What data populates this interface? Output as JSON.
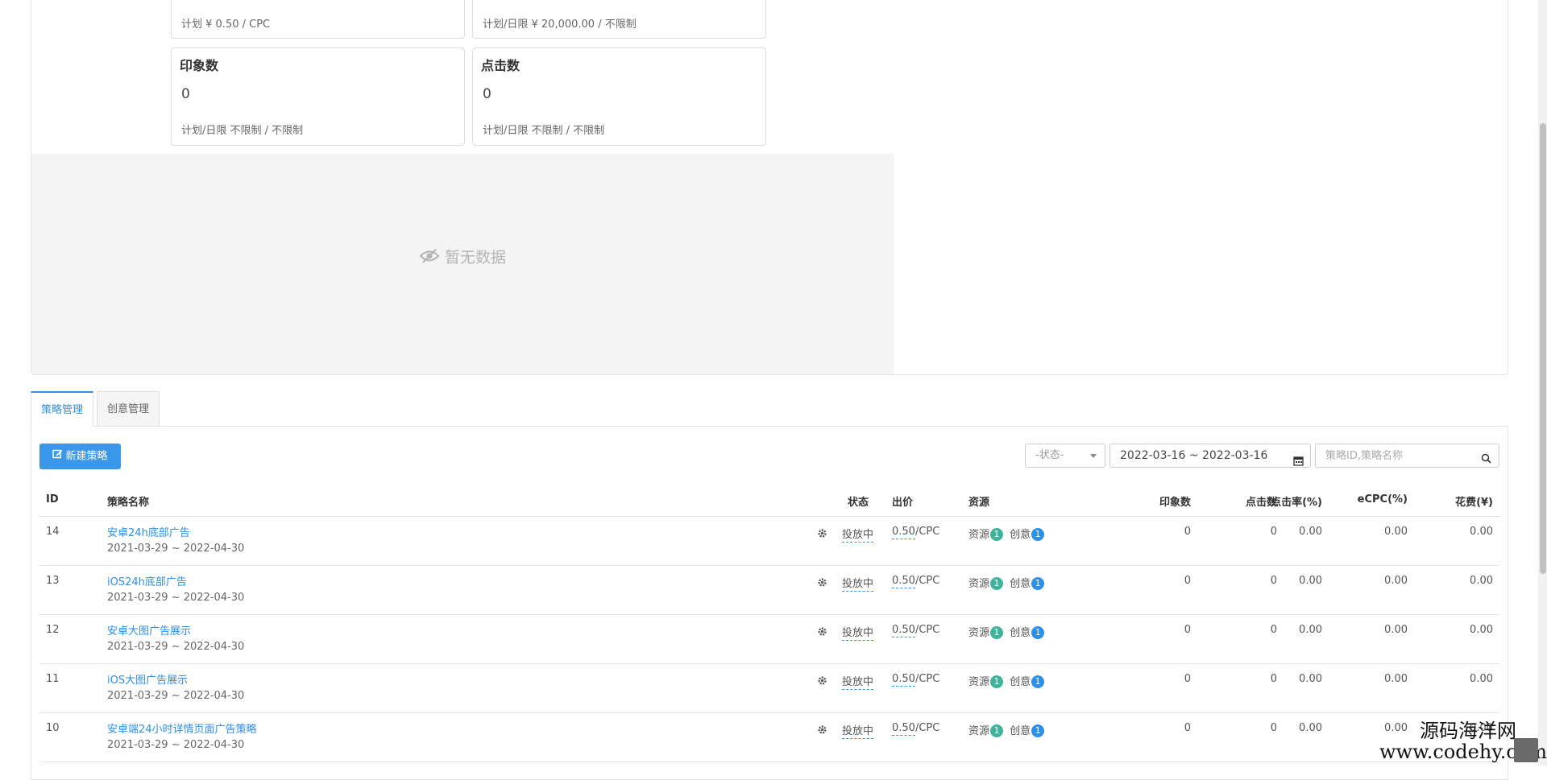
{
  "cards": {
    "top_left": {
      "note": "计划 ¥ 0.50 / CPC"
    },
    "top_right": {
      "note": "计划/日限 ¥ 20,000.00 / 不限制"
    },
    "impressions": {
      "title": "印象数",
      "value": "0",
      "note": "计划/日限 不限制 / 不限制"
    },
    "clicks": {
      "title": "点击数",
      "value": "0",
      "note": "计划/日限 不限制 / 不限制"
    }
  },
  "empty_state": {
    "text": "暂无数据",
    "icon": "eye-slash-icon"
  },
  "tabs": [
    {
      "label": "策略管理",
      "active": true
    },
    {
      "label": "创意管理",
      "active": false
    }
  ],
  "toolbar": {
    "new_button": "新建策略",
    "status_select": "-状态-",
    "date_range": "2022-03-16 ~ 2022-03-16",
    "search_placeholder": "策略ID,策略名称"
  },
  "table": {
    "headers": {
      "id": "ID",
      "name": "策略名称",
      "status": "状态",
      "bid": "出价",
      "resource": "资源",
      "impressions": "印象数",
      "clicks": "点击数",
      "ctr": "点击率(%)",
      "ecpc": "eCPC(%)",
      "cost": "花费(¥)"
    },
    "rows": [
      {
        "id": "14",
        "name": "安卓24h底部广告",
        "date": "2021-03-29 ~ 2022-04-30",
        "status": "投放中",
        "bid": "0.50",
        "bid_unit": "/CPC",
        "resource_label": "资源",
        "resource_count": "1",
        "creative_label": "创意",
        "creative_count": "1",
        "impressions": "0",
        "clicks": "0",
        "ctr": "0.00",
        "ecpc": "0.00",
        "cost": "0.00"
      },
      {
        "id": "13",
        "name": "iOS24h底部广告",
        "date": "2021-03-29 ~ 2022-04-30",
        "status": "投放中",
        "bid": "0.50",
        "bid_unit": "/CPC",
        "resource_label": "资源",
        "resource_count": "1",
        "creative_label": "创意",
        "creative_count": "1",
        "impressions": "0",
        "clicks": "0",
        "ctr": "0.00",
        "ecpc": "0.00",
        "cost": "0.00"
      },
      {
        "id": "12",
        "name": "安卓大图广告展示",
        "date": "2021-03-29 ~ 2022-04-30",
        "status": "投放中",
        "bid": "0.50",
        "bid_unit": "/CPC",
        "resource_label": "资源",
        "resource_count": "1",
        "creative_label": "创意",
        "creative_count": "1",
        "impressions": "0",
        "clicks": "0",
        "ctr": "0.00",
        "ecpc": "0.00",
        "cost": "0.00"
      },
      {
        "id": "11",
        "name": "iOS大图广告展示",
        "date": "2021-03-29 ~ 2022-04-30",
        "status": "投放中",
        "bid": "0.50",
        "bid_unit": "/CPC",
        "resource_label": "资源",
        "resource_count": "1",
        "creative_label": "创意",
        "creative_count": "1",
        "impressions": "0",
        "clicks": "0",
        "ctr": "0.00",
        "ecpc": "0.00",
        "cost": "0.00"
      },
      {
        "id": "10",
        "name": "安卓端24小时详情页面广告策略",
        "date": "2021-03-29 ~ 2022-04-30",
        "status": "投放中",
        "bid": "0.50",
        "bid_unit": "/CPC",
        "resource_label": "资源",
        "resource_count": "1",
        "creative_label": "创意",
        "creative_count": "1",
        "impressions": "0",
        "clicks": "0",
        "ctr": "0.00",
        "ecpc": "0.00",
        "cost": "0.00"
      }
    ]
  },
  "watermark": {
    "line1": "源码海洋网",
    "line2": "www.codehy.com"
  },
  "colors": {
    "accent": "#2d8fe8",
    "button": "#3a97ea",
    "badge_green": "#3fb39b",
    "badge_blue": "#2d8fe8"
  }
}
